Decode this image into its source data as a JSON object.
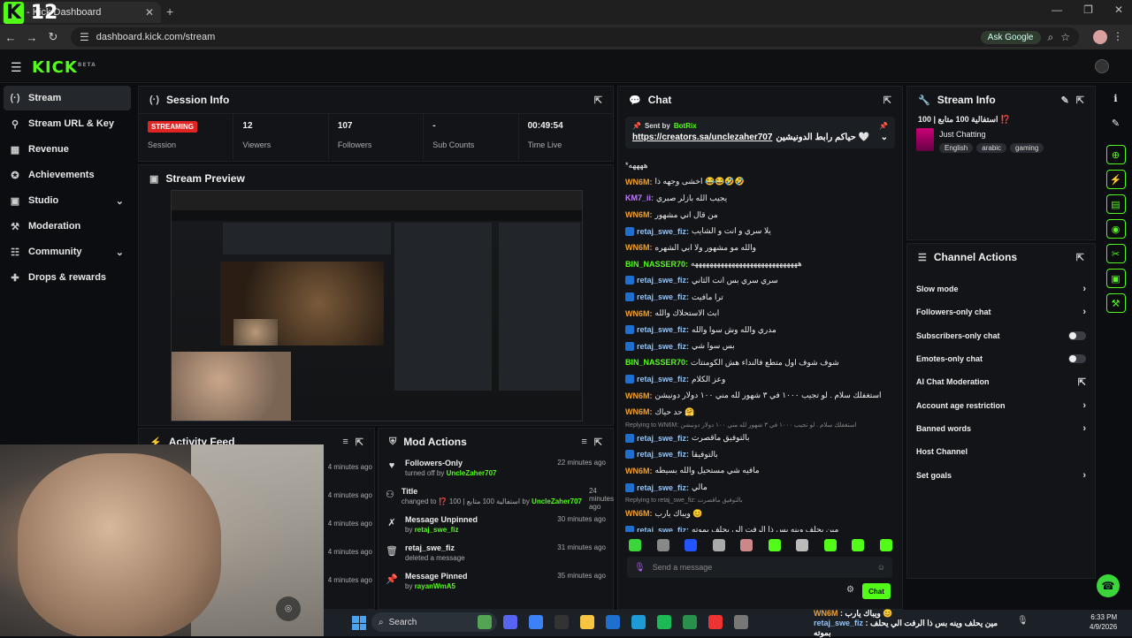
{
  "browser": {
    "tab_title": "- Kick Dashboard",
    "url": "dashboard.kick.com/stream",
    "ask_google": "Ask Google",
    "overlay_number": "12"
  },
  "header": {
    "logo": "KICK",
    "logo_sup": "BETA"
  },
  "sidebar": {
    "items": [
      {
        "label": "Stream",
        "icon": "signal-icon",
        "glyph": "(·)"
      },
      {
        "label": "Stream URL & Key",
        "icon": "link-icon",
        "glyph": "⚲"
      },
      {
        "label": "Revenue",
        "icon": "revenue-icon",
        "glyph": "▦"
      },
      {
        "label": "Achievements",
        "icon": "medal-icon",
        "glyph": "✪"
      },
      {
        "label": "Studio",
        "icon": "studio-icon",
        "glyph": "▣"
      },
      {
        "label": "Moderation",
        "icon": "hammer-icon",
        "glyph": "⚒"
      },
      {
        "label": "Community",
        "icon": "community-icon",
        "glyph": "☷"
      },
      {
        "label": "Drops & rewards",
        "icon": "gift-icon",
        "glyph": "✚"
      }
    ]
  },
  "session": {
    "title": "Session Info",
    "status": "STREAMING",
    "status_label": "Session",
    "viewers": "12",
    "viewers_label": "Viewers",
    "followers": "107",
    "followers_label": "Followers",
    "subs": "-",
    "subs_label": "Sub Counts",
    "time": "00:49:54",
    "time_label": "Time Live"
  },
  "preview": {
    "title": "Stream Preview"
  },
  "chat": {
    "title": "Chat",
    "pinned_sent_by": "Sent by",
    "pinned_user": "BotRix",
    "pinned_link": "https://creators.sa/unclezaher707",
    "pinned_text": "حياكم رابط الدونيشين 🤍",
    "input_placeholder": "Send a message",
    "send_label": "Chat",
    "messages": [
      {
        "user": "",
        "color": "#ffffff",
        "text": "*ههههه",
        "badge": false,
        "reply": false
      },
      {
        "user": "WN6M",
        "color": "#f0a030",
        "text": "اخشى وجهه ذا 😂😂🤣🤣",
        "badge": false,
        "reply": false
      },
      {
        "user": "KM7_ii",
        "color": "#c07cff",
        "text": "يجيب الله بازلر صبري",
        "badge": false,
        "reply": false
      },
      {
        "user": "WN6M",
        "color": "#f0a030",
        "text": "من قال اني مشهور",
        "badge": false,
        "reply": false
      },
      {
        "user": "retaj_swe_fiz",
        "color": "#8ec5ff",
        "text": "يلا سري و انت و الشايب",
        "badge": true,
        "reply": false
      },
      {
        "user": "WN6M",
        "color": "#f0a030",
        "text": "والله مو مشهور ولا ابي الشهره",
        "badge": false,
        "reply": false
      },
      {
        "user": "BIN_NASSER70",
        "color": "#53fc18",
        "text": "هههههههههههههههههههههههههههههه",
        "badge": false,
        "reply": false
      },
      {
        "user": "retaj_swe_fiz",
        "color": "#8ec5ff",
        "text": "سري سري بس انت الثاني",
        "badge": true,
        "reply": false
      },
      {
        "user": "retaj_swe_fiz",
        "color": "#8ec5ff",
        "text": "ترا مافيت",
        "badge": true,
        "reply": false
      },
      {
        "user": "WN6M",
        "color": "#f0a030",
        "text": "ابث الاستحلاك والله",
        "badge": false,
        "reply": false
      },
      {
        "user": "retaj_swe_fiz",
        "color": "#8ec5ff",
        "text": "مدري والله وش سوا والله",
        "badge": true,
        "reply": false
      },
      {
        "user": "retaj_swe_fiz",
        "color": "#8ec5ff",
        "text": "بس سوا شي",
        "badge": true,
        "reply": false
      },
      {
        "user": "BIN_NASSER70",
        "color": "#53fc18",
        "text": "شوف شوف اول متطع فالنداء هش الكومنتات",
        "badge": false,
        "reply": false
      },
      {
        "user": "retaj_swe_fiz",
        "color": "#8ec5ff",
        "text": "وعز الكلام",
        "badge": true,
        "reply": false
      },
      {
        "user": "WN6M",
        "color": "#f0a030",
        "text": "استغفلك سلام . لو تجيب ١٠٠٠ في ٣ شهور لله مني ١٠٠ دولار دونيشن",
        "badge": false,
        "reply": false
      },
      {
        "user": "WN6M",
        "color": "#f0a030",
        "text": "حد حياك 🤗",
        "badge": false,
        "reply": false
      },
      {
        "user": "",
        "color": "#888888",
        "text": "Replying to WN6M: استغفلك سلام . لو تجيب ١٠٠٠ في ٣ شهور لله مني ١٠٠ دولار دونيشن",
        "badge": false,
        "reply": true
      },
      {
        "user": "retaj_swe_fiz",
        "color": "#8ec5ff",
        "text": "بالتوفيق ماقصرت",
        "badge": true,
        "reply": false
      },
      {
        "user": "retaj_swe_fiz",
        "color": "#8ec5ff",
        "text": "بالتوفيقا",
        "badge": true,
        "reply": false
      },
      {
        "user": "WN6M",
        "color": "#f0a030",
        "text": "مافيه شي مستحيل والله بسيطه",
        "badge": false,
        "reply": false
      },
      {
        "user": "retaj_swe_fiz",
        "color": "#8ec5ff",
        "text": "مالي",
        "badge": true,
        "reply": false
      },
      {
        "user": "",
        "color": "#888888",
        "text": "Replying to retaj_swe_fiz: بالتوفيق ماقصرت",
        "badge": false,
        "reply": true
      },
      {
        "user": "WN6M",
        "color": "#f0a030",
        "text": "ويباك يارب 😊",
        "badge": false,
        "reply": false
      },
      {
        "user": "retaj_swe_fiz",
        "color": "#8ec5ff",
        "text": "مين يحلف وينه بس ذا الرفت الي يحلف بموته",
        "badge": true,
        "reply": false
      }
    ],
    "emotes": [
      "#3ad63a",
      "#888888",
      "#2255ff",
      "#aaaaaa",
      "#c88",
      "#53fc18",
      "#bbbbbb",
      "#53fc18",
      "#53fc18",
      "#53fc18"
    ]
  },
  "stream_info": {
    "title": "Stream Info",
    "stream_title": "استفالية 100 متابع | 100 ⁉️",
    "category": "Just Chatting",
    "tags": [
      "English",
      "arabic",
      "gaming"
    ]
  },
  "channel_actions": {
    "title": "Channel Actions",
    "items": [
      {
        "label": "Slow mode",
        "control": "chevron"
      },
      {
        "label": "Followers-only chat",
        "control": "chevron"
      },
      {
        "label": "Subscribers-only chat",
        "control": "toggle"
      },
      {
        "label": "Emotes-only chat",
        "control": "toggle"
      },
      {
        "label": "AI Chat Moderation",
        "control": "external"
      },
      {
        "label": "Account age restriction",
        "control": "chevron"
      },
      {
        "label": "Banned words",
        "control": "chevron"
      },
      {
        "label": "Host Channel",
        "control": "none"
      },
      {
        "label": "Set goals",
        "control": "chevron"
      }
    ]
  },
  "activity": {
    "title": "Activity Feed",
    "times": [
      "4 minutes ago",
      "4 minutes ago",
      "4 minutes ago",
      "4 minutes ago",
      "4 minutes ago"
    ]
  },
  "mod_actions": {
    "title": "Mod Actions",
    "items": [
      {
        "icon": "heart-icon",
        "glyph": "♥",
        "title": "Followers-Only",
        "sub_pre": "turned off by",
        "sub_hl": "UncleZaher707",
        "time": "22 minutes ago"
      },
      {
        "icon": "title-icon",
        "glyph": "⚇",
        "title": "Title",
        "sub_pre": "changed to ⁉️ 100 | استفالية 100 متابع  by",
        "sub_hl": "UncleZaher707",
        "time": "24 minutes ago"
      },
      {
        "icon": "unpin-icon",
        "glyph": "✗",
        "title": "Message Unpinned",
        "sub_pre": "by",
        "sub_hl": "retaj_swe_fiz",
        "time": "30 minutes ago"
      },
      {
        "icon": "trash-icon",
        "glyph": "🗑",
        "title": "retaj_swe_fiz",
        "sub_pre": "deleted a message",
        "sub_hl": "",
        "time": "31 minutes ago"
      },
      {
        "icon": "pin-icon",
        "glyph": "📌",
        "title": "Message Pinned",
        "sub_pre": "by",
        "sub_hl": "rayanWmA5",
        "time": "35 minutes ago"
      }
    ]
  },
  "taskbar": {
    "search": "Search",
    "ticker_user1": "WN6M",
    "ticker_text1": ": ويباك يارب 😊",
    "ticker_user2": "retaj_swe_fiz",
    "ticker_text2": ": مين يحلف وينه بس ذا الرفت الي يحلف بموته",
    "time": "6:33 PM",
    "date": "4/9/2026",
    "apps": [
      "#53a553",
      "#5865f2",
      "#3b82f6",
      "#333333",
      "#f5c542",
      "#1e6fd0",
      "#1e9bd7",
      "#1db954",
      "#2a8f4a",
      "#e33",
      "#777777"
    ]
  }
}
